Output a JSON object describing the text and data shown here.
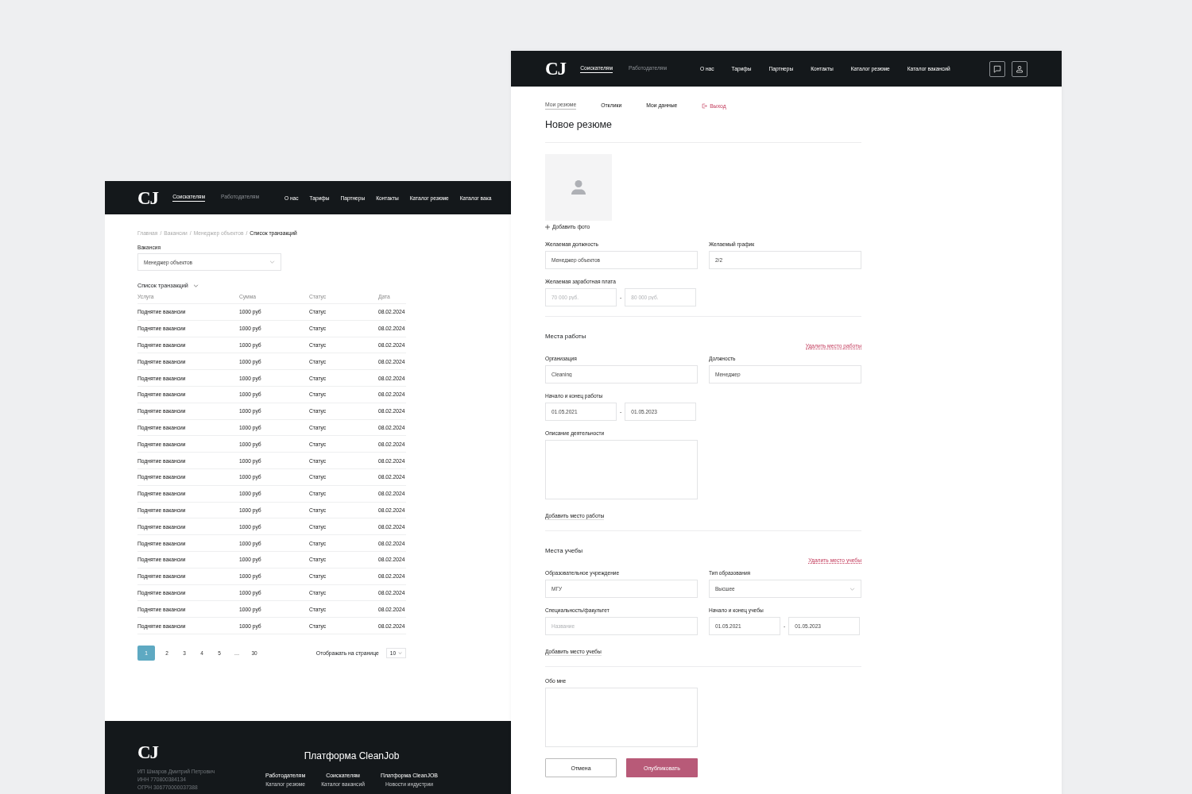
{
  "left_screen": {
    "header": {
      "logo": "CJ",
      "audience_tabs": [
        {
          "label": "Соискателям",
          "selected": true
        },
        {
          "label": "Работодателям",
          "selected": false
        }
      ],
      "nav": [
        "О нас",
        "Тарифы",
        "Партнеры",
        "Контакты",
        "Каталог резюме",
        "Каталог вака"
      ]
    },
    "breadcrumb": {
      "separator": "/",
      "items": [
        {
          "label": "Главная",
          "current": false
        },
        {
          "label": "Вакансии",
          "current": false
        },
        {
          "label": "Менеджер объектов",
          "current": false
        },
        {
          "label": "Список транзакций",
          "current": true
        }
      ]
    },
    "vacancy_select": {
      "label": "Вакансия",
      "value": "Менеджер объектов"
    },
    "section_title": "Список транзакций",
    "table": {
      "columns": [
        "Услуга",
        "Сумма",
        "Статус",
        "Дата"
      ],
      "rows": [
        [
          "Поднятие вакансии",
          "1000 руб",
          "Статус",
          "08.02.2024"
        ],
        [
          "Поднятие вакансии",
          "1000 руб",
          "Статус",
          "08.02.2024"
        ],
        [
          "Поднятие вакансии",
          "1000 руб",
          "Статус",
          "08.02.2024"
        ],
        [
          "Поднятие вакансии",
          "1000 руб",
          "Статус",
          "08.02.2024"
        ],
        [
          "Поднятие вакансии",
          "1000 руб",
          "Статус",
          "08.02.2024"
        ],
        [
          "Поднятие вакансии",
          "1000 руб",
          "Статус",
          "08.02.2024"
        ],
        [
          "Поднятие вакансии",
          "1000 руб",
          "Статус",
          "08.02.2024"
        ],
        [
          "Поднятие вакансии",
          "1000 руб",
          "Статус",
          "08.02.2024"
        ],
        [
          "Поднятие вакансии",
          "1000 руб",
          "Статус",
          "08.02.2024"
        ],
        [
          "Поднятие вакансии",
          "1000 руб",
          "Статус",
          "08.02.2024"
        ],
        [
          "Поднятие вакансии",
          "1000 руб",
          "Статус",
          "08.02.2024"
        ],
        [
          "Поднятие вакансии",
          "1000 руб",
          "Статус",
          "08.02.2024"
        ],
        [
          "Поднятие вакансии",
          "1000 руб",
          "Статус",
          "08.02.2024"
        ],
        [
          "Поднятие вакансии",
          "1000 руб",
          "Статус",
          "08.02.2024"
        ],
        [
          "Поднятие вакансии",
          "1000 руб",
          "Статус",
          "08.02.2024"
        ],
        [
          "Поднятие вакансии",
          "1000 руб",
          "Статус",
          "08.02.2024"
        ],
        [
          "Поднятие вакансии",
          "1000 руб",
          "Статус",
          "08.02.2024"
        ],
        [
          "Поднятие вакансии",
          "1000 руб",
          "Статус",
          "08.02.2024"
        ],
        [
          "Поднятие вакансии",
          "1000 руб",
          "Статус",
          "08.02.2024"
        ],
        [
          "Поднятие вакансии",
          "1000 руб",
          "Статус",
          "08.02.2024"
        ]
      ]
    },
    "pagination": {
      "pages": [
        {
          "label": "1",
          "selected": true
        },
        {
          "label": "2",
          "selected": false
        },
        {
          "label": "3",
          "selected": false
        },
        {
          "label": "4",
          "selected": false
        },
        {
          "label": "5",
          "selected": false
        },
        {
          "label": "…",
          "selected": false
        },
        {
          "label": "30",
          "selected": false
        }
      ],
      "per_page_label": "Отображать на странице",
      "per_page_value": "10"
    },
    "footer": {
      "logo": "CJ",
      "legal": [
        "ИП Шмаров Дмитрий Петрович",
        "ИНН 770800384134",
        "ОГРН 306770000037388"
      ],
      "title": "Платформа CleanJob",
      "columns": [
        {
          "heading": "Работодателям",
          "links": [
            "Каталог резюме"
          ]
        },
        {
          "heading": "Соискателям",
          "links": [
            "Каталог вакансий"
          ]
        },
        {
          "heading": "Платформа CleanJOB",
          "links": [
            "Новости индустрии"
          ]
        }
      ]
    }
  },
  "right_screen": {
    "header": {
      "logo": "CJ",
      "audience_tabs": [
        {
          "label": "Соискателям",
          "selected": true
        },
        {
          "label": "Работодателям",
          "selected": false
        }
      ],
      "nav": [
        "О нас",
        "Тарифы",
        "Партнеры",
        "Контакты",
        "Каталог резюме",
        "Каталог вакансий"
      ]
    },
    "account_tabs": [
      {
        "label": "Мои резюме",
        "selected": true
      },
      {
        "label": "Отклики",
        "selected": false
      },
      {
        "label": "Мои данные",
        "selected": false
      }
    ],
    "logout": "Выход",
    "title": "Новое резюме",
    "add_photo": "Добавить фото",
    "sections": [
      {
        "rows": [
          [
            {
              "kind": "input",
              "label": "Желаемая должность",
              "value": "Менеджер объектов"
            },
            {
              "kind": "input",
              "label": "Желаемый график",
              "value": "2/2"
            }
          ],
          [
            {
              "kind": "range",
              "label": "Желаемая заработная плата",
              "separator": "-",
              "from": {
                "placeholder": "70 000 руб."
              },
              "to": {
                "placeholder": "80 000 руб."
              }
            }
          ]
        ]
      },
      {
        "title": "Места работы",
        "remove_link": "Удалить место работы",
        "rows": [
          [
            {
              "kind": "input",
              "label": "Организация",
              "value": "Cleaning"
            },
            {
              "kind": "input",
              "label": "Должность",
              "value": "Менеджер"
            }
          ],
          [
            {
              "kind": "range",
              "label": "Начало и конец работы",
              "separator": "-",
              "from": {
                "value": "01.05.2021"
              },
              "to": {
                "value": "01.05.2023"
              }
            }
          ],
          [
            {
              "kind": "textarea",
              "label": "Описание деятельности"
            }
          ]
        ],
        "add_link": "Добавить место работы"
      },
      {
        "title": "Места учебы",
        "remove_link": "Удалить место учебы",
        "rows": [
          [
            {
              "kind": "input",
              "label": "Образовательное учреждение",
              "value": "МГУ"
            },
            {
              "kind": "select",
              "label": "Тип образования",
              "value": "Высшее"
            }
          ],
          [
            {
              "kind": "input",
              "label": "Специальность/факультет",
              "placeholder": "Название"
            },
            {
              "kind": "range",
              "label": "Начало и конец учебы",
              "separator": "-",
              "from": {
                "value": "01.05.2021"
              },
              "to": {
                "value": "01.05.2023"
              }
            }
          ]
        ],
        "add_link": "Добавить место учебы"
      },
      {
        "rows": [
          [
            {
              "kind": "textarea",
              "label": "Обо мне"
            }
          ]
        ]
      }
    ],
    "buttons": [
      {
        "label": "Отмена",
        "kind": "secondary"
      },
      {
        "label": "Опубликовать",
        "kind": "primary"
      }
    ]
  }
}
